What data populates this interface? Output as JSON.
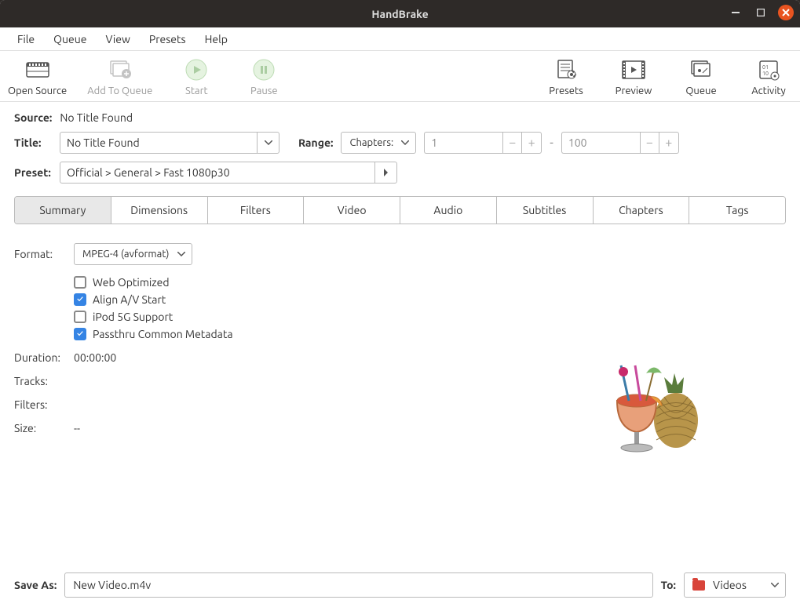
{
  "window": {
    "title": "HandBrake"
  },
  "menubar": [
    "File",
    "Queue",
    "View",
    "Presets",
    "Help"
  ],
  "toolbar": {
    "left": [
      {
        "label": "Open Source",
        "name": "open-source-button"
      },
      {
        "label": "Add To Queue",
        "name": "add-to-queue-button"
      },
      {
        "label": "Start",
        "name": "start-button"
      },
      {
        "label": "Pause",
        "name": "pause-button"
      }
    ],
    "right": [
      {
        "label": "Presets",
        "name": "presets-button"
      },
      {
        "label": "Preview",
        "name": "preview-button"
      },
      {
        "label": "Queue",
        "name": "queue-button"
      },
      {
        "label": "Activity",
        "name": "activity-button"
      }
    ]
  },
  "source": {
    "label": "Source:",
    "value": "No Title Found"
  },
  "title": {
    "label": "Title:",
    "value": "No Title Found"
  },
  "range": {
    "label": "Range:",
    "type": "Chapters:",
    "from": "1",
    "to": "100",
    "sep": "-"
  },
  "preset": {
    "label": "Preset:",
    "value": "Official > General > Fast 1080p30"
  },
  "tabs": [
    "Summary",
    "Dimensions",
    "Filters",
    "Video",
    "Audio",
    "Subtitles",
    "Chapters",
    "Tags"
  ],
  "summary": {
    "format_label": "Format:",
    "format_value": "MPEG-4 (avformat)",
    "options": [
      {
        "label": "Web Optimized",
        "checked": false
      },
      {
        "label": "Align A/V Start",
        "checked": true
      },
      {
        "label": "iPod 5G Support",
        "checked": false
      },
      {
        "label": "Passthru Common Metadata",
        "checked": true
      }
    ],
    "duration_label": "Duration:",
    "duration_value": "00:00:00",
    "tracks_label": "Tracks:",
    "filters_label": "Filters:",
    "size_label": "Size:",
    "size_value": "--"
  },
  "saveas": {
    "label": "Save As:",
    "value": "New Video.m4v"
  },
  "to": {
    "label": "To:",
    "value": "Videos"
  }
}
